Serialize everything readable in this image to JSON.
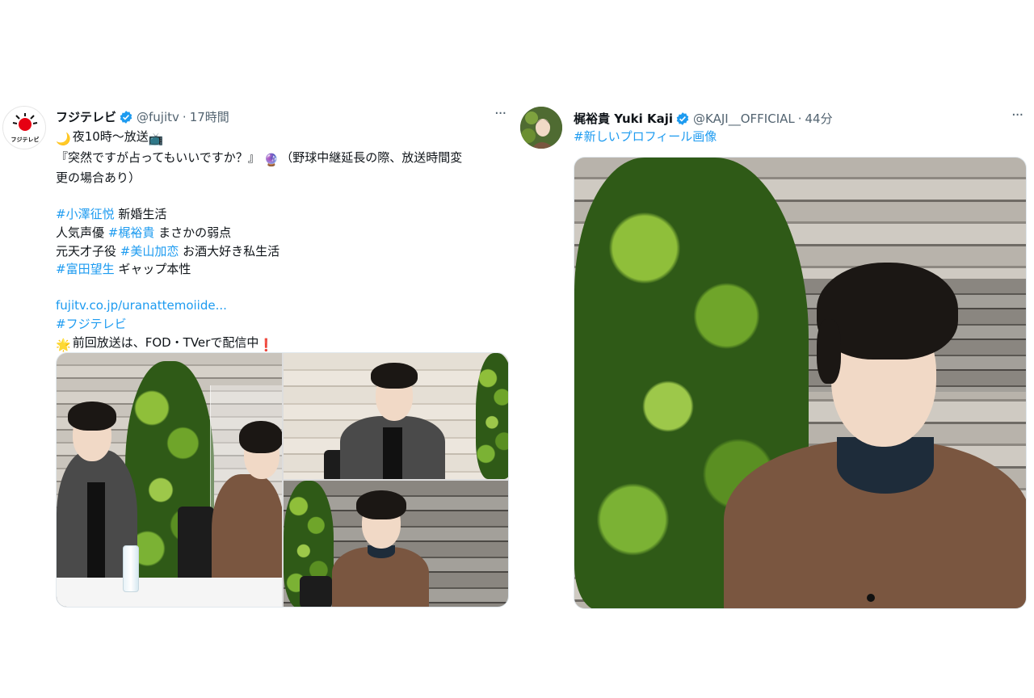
{
  "tweets": [
    {
      "name": "フジテレビ",
      "handle": "@fujitv",
      "separator": "·",
      "time": "17時間",
      "more": "···",
      "avatar_text": "フジテレビ",
      "lines": [
        {
          "emoji": "🌙",
          "parts": [
            {
              "t": "夜10時〜放送"
            }
          ],
          "emoji_after": "📺"
        },
        {
          "parts": [
            {
              "t": "『突然ですが占ってもいいですか？』"
            }
          ],
          "emoji_after": "🔮",
          "rest": "（野球中継延長の際、放送時間変"
        },
        {
          "parts": [
            {
              "t": "更の場合あり）"
            }
          ]
        },
        {
          "blank": true
        },
        {
          "parts": [
            {
              "t": "#小澤征悦",
              "tag": true
            },
            {
              "t": " 新婚生活"
            }
          ]
        },
        {
          "parts": [
            {
              "t": "人気声優 "
            },
            {
              "t": "#梶裕貴",
              "tag": true
            },
            {
              "t": " まさかの弱点"
            }
          ]
        },
        {
          "parts": [
            {
              "t": "元天才子役 "
            },
            {
              "t": "#美山加恋",
              "tag": true
            },
            {
              "t": " お酒大好き私生活"
            }
          ]
        },
        {
          "parts": [
            {
              "t": "#富田望生",
              "tag": true
            },
            {
              "t": " ギャップ本性"
            }
          ]
        },
        {
          "blank": true
        },
        {
          "parts": [
            {
              "t": "fujitv.co.jp/uranattemoiide...",
              "tag": true
            }
          ]
        },
        {
          "parts": [
            {
              "t": "#フジテレビ",
              "tag": true
            }
          ]
        },
        {
          "emoji": "🌟",
          "parts": [
            {
              "t": "前回放送は、FOD・TVerで配信中"
            }
          ],
          "emoji_after": "❗"
        }
      ]
    },
    {
      "name": "梶裕貴 Yuki Kaji",
      "handle": "@KAJI__OFFICIAL",
      "separator": "·",
      "time": "44分",
      "more": "···",
      "lines": [
        {
          "parts": [
            {
              "t": "#新しいプロフィール画像",
              "tag": true
            }
          ]
        }
      ]
    }
  ],
  "colors": {
    "link": "#1d9bf0",
    "verified": "#1d9bf0",
    "muted": "#536471",
    "fuji_red": "#e60012",
    "shirt_brown": "#7a5640",
    "jacket_gray": "#4a4a4a"
  },
  "icons": [
    "verified-badge-icon",
    "more-options-icon"
  ]
}
